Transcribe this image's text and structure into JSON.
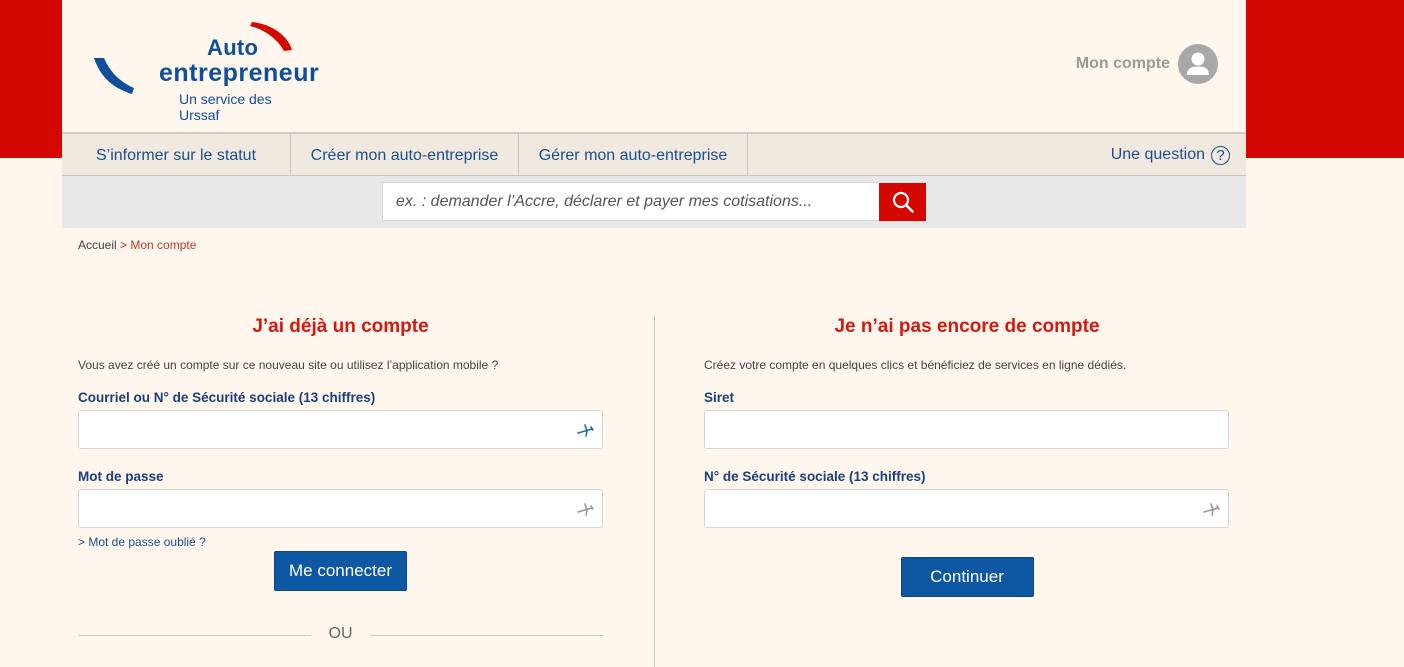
{
  "logo": {
    "line1": "Auto",
    "line2": "entrepreneur",
    "tagline": "Un service des Urssaf"
  },
  "header": {
    "account_label": "Mon compte"
  },
  "nav": {
    "items": [
      {
        "label": "S’informer sur le statut"
      },
      {
        "label": "Créer mon auto-entreprise"
      },
      {
        "label": "Gérer mon auto-entreprise"
      }
    ],
    "question_label": "Une question",
    "question_glyph": "?"
  },
  "search": {
    "placeholder": "ex. : demander l’Accre, déclarer et payer mes cotisations..."
  },
  "breadcrumb": {
    "home": "Accueil",
    "current": "> Mon compte"
  },
  "login": {
    "title": "J’ai déjà un compte",
    "intro": "Vous avez créé un compte sur ce nouveau site ou utilisez l’application mobile ?",
    "id_label": "Courriel ou N° de Sécurité sociale (13 chiffres)",
    "id_value": "",
    "password_label": "Mot de passe",
    "password_value": "",
    "forgot": "> Mot de passe oublié ?",
    "submit": "Me connecter",
    "or": "OU"
  },
  "signup": {
    "title": "Je n’ai pas encore de compte",
    "intro": "Créez votre compte en quelques clics et bénéficiez de services en ligne dédiés.",
    "siret_label": "Siret",
    "siret_value": "",
    "nss_label": "N° de Sécurité sociale (13 chiffres)",
    "nss_value": "",
    "submit": "Continuer"
  },
  "icons": {
    "search": "search-icon",
    "account": "user-icon",
    "question": "question-icon",
    "autofill": "key-icon"
  },
  "colors": {
    "brand_red": "#d40800",
    "brand_blue": "#0e4f9c",
    "button_blue": "#0d57a3",
    "background": "#fff6ee"
  }
}
